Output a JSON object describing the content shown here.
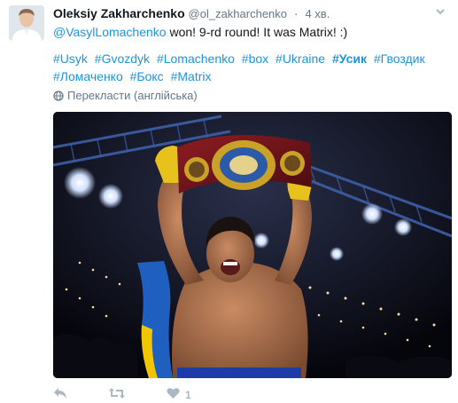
{
  "tweet": {
    "author_name": "Oleksiy Zakharchenko",
    "author_handle": "@ol_zakharchenko",
    "separator": "·",
    "time": "4 хв.",
    "mention": "@VasylLomachenko",
    "body_text": " won! 9-rd round! It was Matrix! :)",
    "hashtags": [
      {
        "text": "#Usyk",
        "bold": false
      },
      {
        "text": "#Gvozdyk",
        "bold": false
      },
      {
        "text": "#Lomachenko",
        "bold": false
      },
      {
        "text": "#box",
        "bold": false
      },
      {
        "text": "#Ukraine",
        "bold": false
      },
      {
        "text": "#Усик",
        "bold": true
      },
      {
        "text": "#Гвоздик",
        "bold": false
      },
      {
        "text": "#Ломаченко",
        "bold": false
      },
      {
        "text": "#Бокс",
        "bold": false
      },
      {
        "text": "#Matrix",
        "bold": false
      }
    ],
    "translate_label": "Перекласти (англійська)",
    "likes": "1"
  },
  "icons": {
    "more": "chevron-down-icon",
    "reply": "reply-icon",
    "retweet": "retweet-icon",
    "like": "heart-icon",
    "translate": "globe-icon"
  },
  "colors": {
    "link": "#1b95e0",
    "muted": "#657786",
    "icon": "#aab8c2",
    "text": "#14171a"
  }
}
